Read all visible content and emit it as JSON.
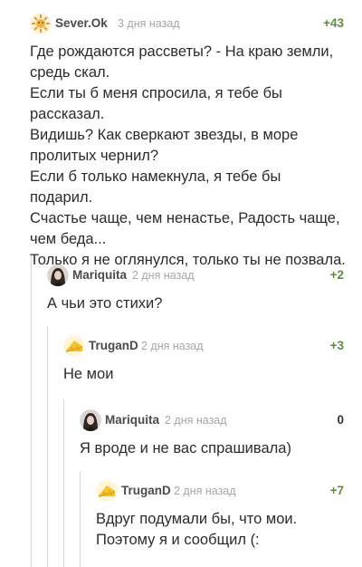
{
  "comments": [
    {
      "author": "Sever.Ok",
      "time": "3 дня назад",
      "rating": "+43",
      "avatar": "sun-avatar",
      "text": "Где рождаются рассветы? - На краю земли, средь скал.\nЕсли ты б меня спросила, я тебе бы рассказал.\nВидишь? Как сверкают звезды, в море пролитых чернил?\nЕсли б только намекнула, я тебе бы подарил.\nСчастье чаще, чем ненастье, Радость чаще, чем беда...\nТолько я не оглянулся, только ты не позвала."
    },
    {
      "author": "Mariquita",
      "time": "2 дня назад",
      "rating": "+2",
      "avatar": "woman-avatar",
      "text": "А чьи это стихи?"
    },
    {
      "author": "TruganD",
      "time": "2 дня назад",
      "rating": "+3",
      "avatar": "cheese-avatar",
      "text": "Не мои"
    },
    {
      "author": "Mariquita",
      "time": "2 дня назад",
      "rating": "0",
      "avatar": "woman-avatar",
      "text": "Я вроде и не вас спрашивала)"
    },
    {
      "author": "TruganD",
      "time": "2 дня назад",
      "rating": "+7",
      "avatar": "cheese-avatar",
      "text": "Вдруг подумали бы, что мои.\nПоэтому я и сообщил (:"
    }
  ],
  "colors": {
    "rating_positive": "#5c8f3c",
    "rating_neutral": "#333333",
    "thread_line": "#d8d8d8",
    "time": "#a6a6a6"
  }
}
